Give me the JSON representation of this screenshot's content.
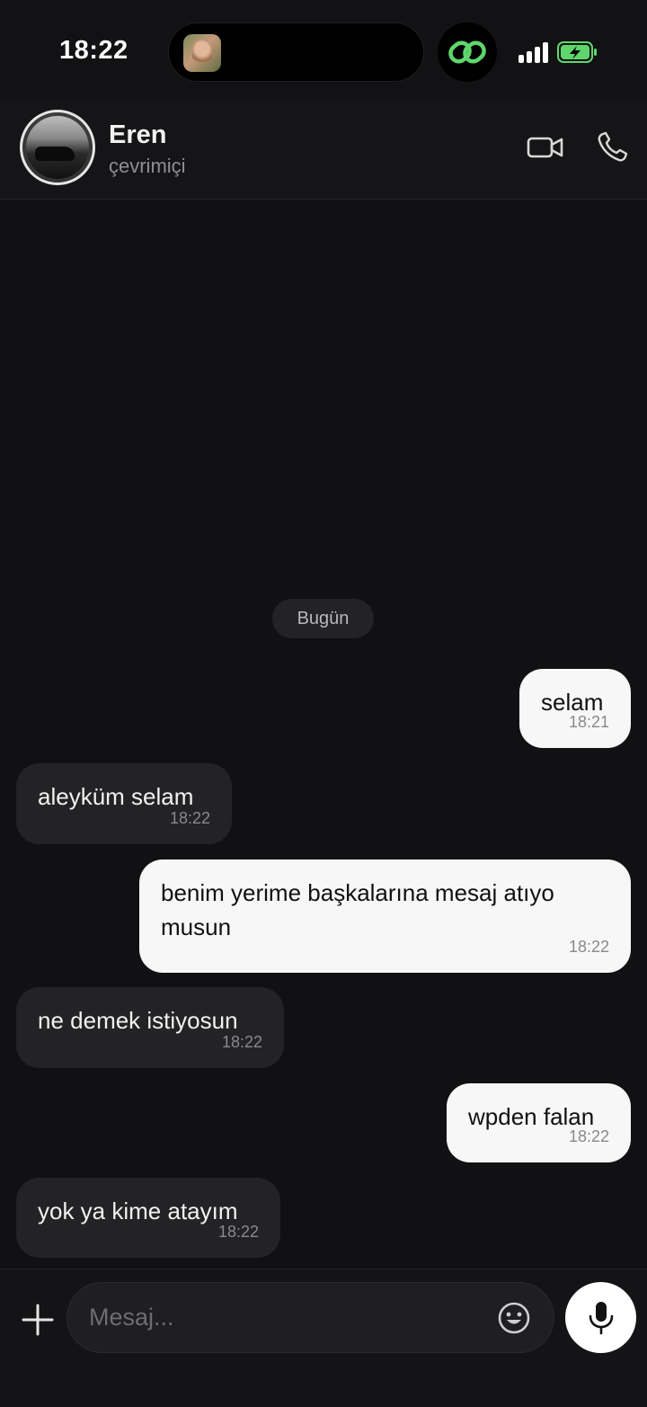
{
  "status_bar": {
    "time": "18:22"
  },
  "header": {
    "name": "Eren",
    "status": "çevrimiçi"
  },
  "chat": {
    "date_chip": "Bugün",
    "messages": [
      {
        "dir": "out",
        "text": "selam",
        "time": "18:21"
      },
      {
        "dir": "in",
        "text": "aleyküm selam",
        "time": "18:22"
      },
      {
        "dir": "out",
        "text": "benim yerime başkalarına mesaj atıyo musun",
        "time": "18:22"
      },
      {
        "dir": "in",
        "text": "ne demek istiyosun",
        "time": "18:22"
      },
      {
        "dir": "out",
        "text": "wpden falan",
        "time": "18:22"
      },
      {
        "dir": "in",
        "text": "yok ya kime atayım",
        "time": "18:22"
      }
    ]
  },
  "composer": {
    "placeholder": "Mesaj..."
  },
  "icons": {
    "video": "video-camera-icon",
    "call": "phone-icon",
    "plus": "plus-icon",
    "emoji": "smiley-icon",
    "mic": "microphone-icon",
    "island": "link-icon"
  },
  "colors": {
    "outgoing_bubble": "#f7f7f7",
    "incoming_bubble": "#232325",
    "background": "#111113",
    "accent": "#34c759"
  }
}
